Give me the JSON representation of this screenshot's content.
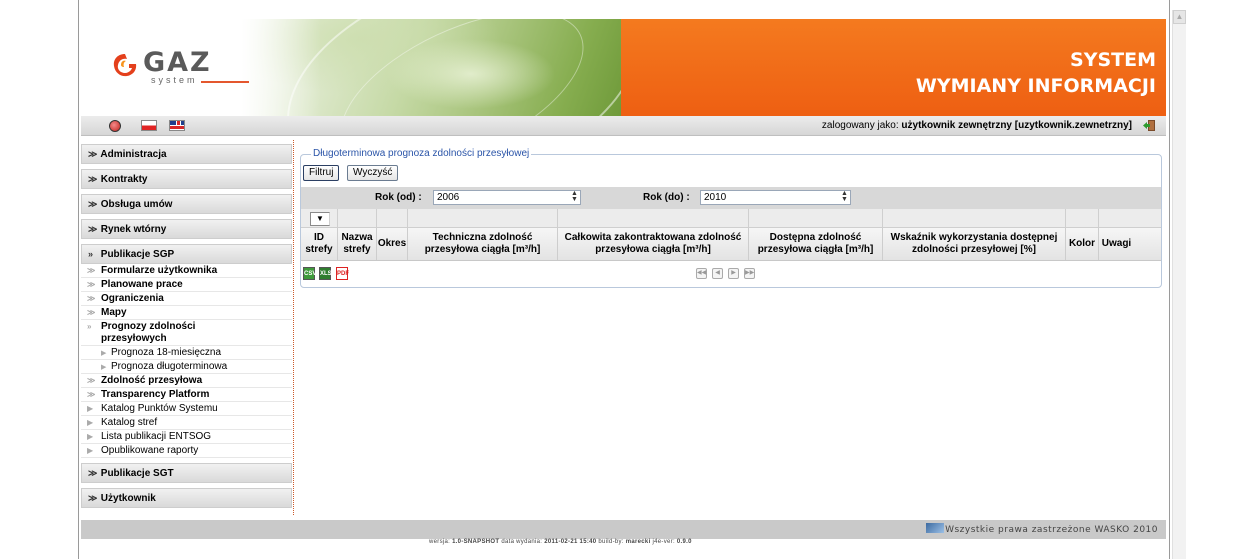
{
  "header": {
    "logo_word": "GAZ",
    "logo_sub": "system",
    "title_line1": "SYSTEM",
    "title_line2": "WYMIANY INFORMACJI"
  },
  "topbar": {
    "user_prefix": "zalogowany jako:",
    "user_name": "użytkownik zewnętrzny [uzytkownik.zewnetrzny]"
  },
  "sidebar": {
    "sections": [
      {
        "label": "Administracja",
        "chev": "≫"
      },
      {
        "label": "Kontrakty",
        "chev": "≫"
      },
      {
        "label": "Obsługa umów",
        "chev": "≫"
      },
      {
        "label": "Rynek wtórny",
        "chev": "≫"
      },
      {
        "label": "Publikacje SGP",
        "chev": "≫"
      }
    ],
    "publikacje_items": [
      "Formularze użytkownika",
      "Planowane prace",
      "Ograniczenia",
      "Mapy",
      "Prognozy zdolności przesyłowych",
      "Prognoza 18-miesięczna",
      "Prognoza długoterminowa",
      "Zdolność przesyłowa",
      "Transparency Platform",
      "Katalog Punktów Systemu",
      "Katalog stref",
      "Lista publikacji ENTSOG",
      "Opublikowane raporty"
    ],
    "sections_bottom": [
      {
        "label": "Publikacje SGT",
        "chev": "≫"
      },
      {
        "label": "Użytkownik",
        "chev": "≫"
      }
    ]
  },
  "panel": {
    "legend": "Długoterminowa prognoza zdolności przesyłowej",
    "filter_button": "Filtruj",
    "clear_button": "Wyczyść",
    "year_from_label": "Rok (od) :",
    "year_from_value": "2006",
    "year_to_label": "Rok (do) :",
    "year_to_value": "2010",
    "columns": [
      "ID strefy",
      "Nazwa strefy",
      "Okres",
      "Techniczna zdolność przesyłowa ciągła [m³/h]",
      "Całkowita zakontraktowana zdolność przesyłowa ciągła [m³/h]",
      "Dostępna zdolność przesyłowa ciągła [m³/h]",
      "Wskaźnik wykorzystania dostępnej zdolności przesyłowej [%]",
      "Kolor",
      "Uwagi"
    ],
    "export_csv": "CSV",
    "export_xls": "XLS",
    "export_pdf": "PDF"
  },
  "footer": {
    "copyright": "Wszystkie prawa zastrzeżone WASKO 2010",
    "version_prefix": "wersja:",
    "version": "1.0-SNAPSHOT",
    "date_prefix": "data wydania:",
    "date": "2011-02-21 15:40",
    "build_prefix": "build-by:",
    "build_by": "marecki",
    "jre_prefix": "j4e-ver:",
    "jre": "0.9.0"
  }
}
